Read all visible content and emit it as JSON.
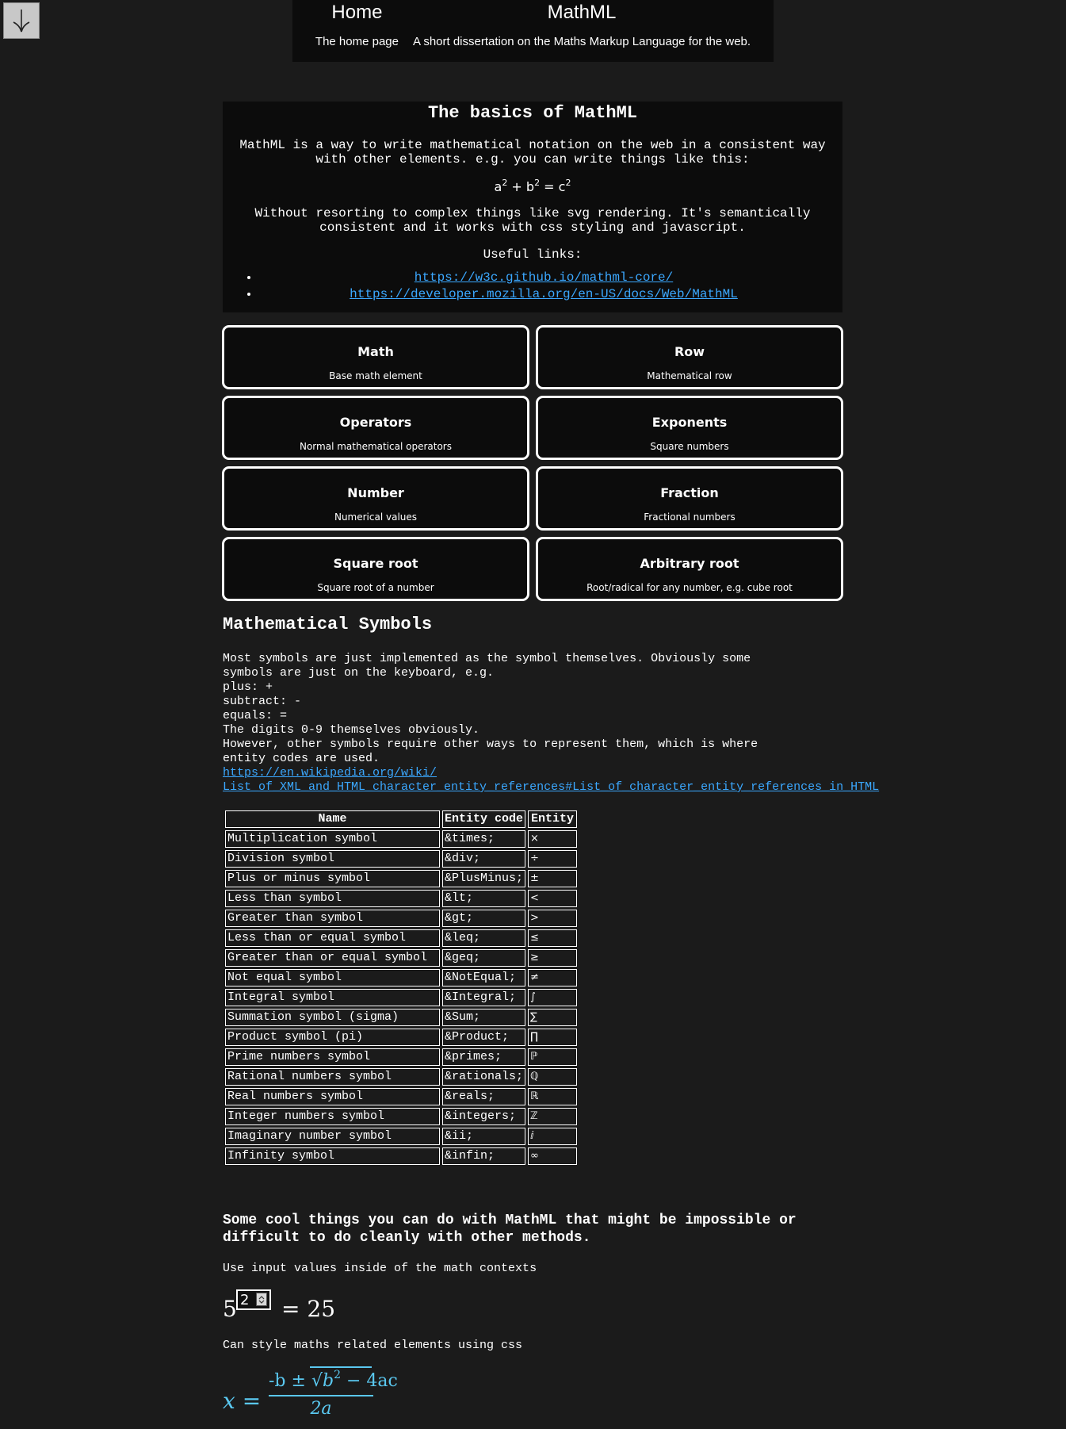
{
  "nav": [
    {
      "title": "Home",
      "subtitle": "The home page"
    },
    {
      "title": "MathML",
      "subtitle": "A short dissertation on the Maths Markup Language for the web."
    }
  ],
  "intro": {
    "heading": "The basics of MathML",
    "para1": "MathML is a way to write mathematical notation on the web in a consistent way with other elements. e.g. you can write things like this:",
    "equation": {
      "a": "a",
      "b": "b",
      "c": "c",
      "exp": "2",
      "plus": "+",
      "eq": "="
    },
    "para2": "Without resorting to complex things like svg rendering. It's semantically consistent and it works with css styling and javascript.",
    "links_label": "Useful links:",
    "links": [
      "https://w3c.github.io/mathml-core/",
      "https://developer.mozilla.org/en-US/docs/Web/MathML"
    ]
  },
  "cards": [
    {
      "title": "Math",
      "subtitle": "Base math element"
    },
    {
      "title": "Row",
      "subtitle": "Mathematical row"
    },
    {
      "title": "Operators",
      "subtitle": "Normal mathematical operators"
    },
    {
      "title": "Exponents",
      "subtitle": "Square numbers"
    },
    {
      "title": "Number",
      "subtitle": "Numerical values"
    },
    {
      "title": "Fraction",
      "subtitle": "Fractional numbers"
    },
    {
      "title": "Square root",
      "subtitle": "Square root of a number"
    },
    {
      "title": "Arbitrary root",
      "subtitle": "Root/radical for any number, e.g. cube root"
    }
  ],
  "symbols": {
    "heading": "Mathematical Symbols",
    "lines": [
      "Most symbols are just implemented as the symbol themselves. Obviously some",
      "symbols are just on the keyboard, e.g.",
      "plus: +",
      "subtract: -",
      "equals: =",
      "The digits 0-9 themselves obviously.",
      "However, other symbols require other ways to represent them, which is where",
      "entity codes are used."
    ],
    "wiki_link_line1": "https://en.wikipedia.org/wiki/",
    "wiki_link_line2": "List_of_XML_and_HTML_character_entity_references#List_of_character_entity_references_in_HTML"
  },
  "table": {
    "headers": [
      "Name",
      "Entity code",
      "Entity"
    ],
    "rows": [
      [
        "Multiplication symbol",
        "&times;",
        "×"
      ],
      [
        "Division symbol",
        "&div;",
        "÷"
      ],
      [
        "Plus or minus symbol",
        "&PlusMinus;",
        "±"
      ],
      [
        "Less than symbol",
        "&lt;",
        "<"
      ],
      [
        "Greater than symbol",
        "&gt;",
        ">"
      ],
      [
        "Less than or equal symbol",
        "&leq;",
        "≤"
      ],
      [
        "Greater than or equal symbol",
        "&geq;",
        "≥"
      ],
      [
        "Not equal symbol",
        "&NotEqual;",
        "≠"
      ],
      [
        "Integral symbol",
        "&Integral;",
        "∫"
      ],
      [
        "Summation symbol (sigma)",
        "&Sum;",
        "∑"
      ],
      [
        "Product symbol (pi)",
        "&Product;",
        "∏"
      ],
      [
        "Prime numbers symbol",
        "&primes;",
        "ℙ"
      ],
      [
        "Rational numbers symbol",
        "&rationals;",
        "ℚ"
      ],
      [
        "Real numbers symbol",
        "&reals;",
        "ℝ"
      ],
      [
        "Integer numbers symbol",
        "&integers;",
        "ℤ"
      ],
      [
        "Imaginary number symbol",
        "&ii;",
        "ⅈ"
      ],
      [
        "Infinity symbol",
        "&infin;",
        "∞"
      ]
    ]
  },
  "cool": {
    "heading": "Some cool things you can do with MathML that might be impossible or difficult to do cleanly with other methods.",
    "para1": "Use input values inside of the math contexts",
    "power": {
      "base": "5",
      "exponent_value": "2",
      "equals": "=",
      "result": "25"
    },
    "para2": "Can style maths related elements using css",
    "quadratic": {
      "lhs": "x =",
      "numerator": "-b ± ",
      "radicand_b": "b",
      "radicand_exp": "2",
      "radicand_rest": " − 4ac",
      "denominator": "2a"
    }
  },
  "colors": {
    "background": "#1b1b1b",
    "panel": "#0c0c0c",
    "link": "#3ba8ff",
    "math_accent": "#5ac8f0"
  },
  "icons": {
    "scroll_button": "arrow-down-icon",
    "spinner": "spinner-arrows-icon"
  }
}
